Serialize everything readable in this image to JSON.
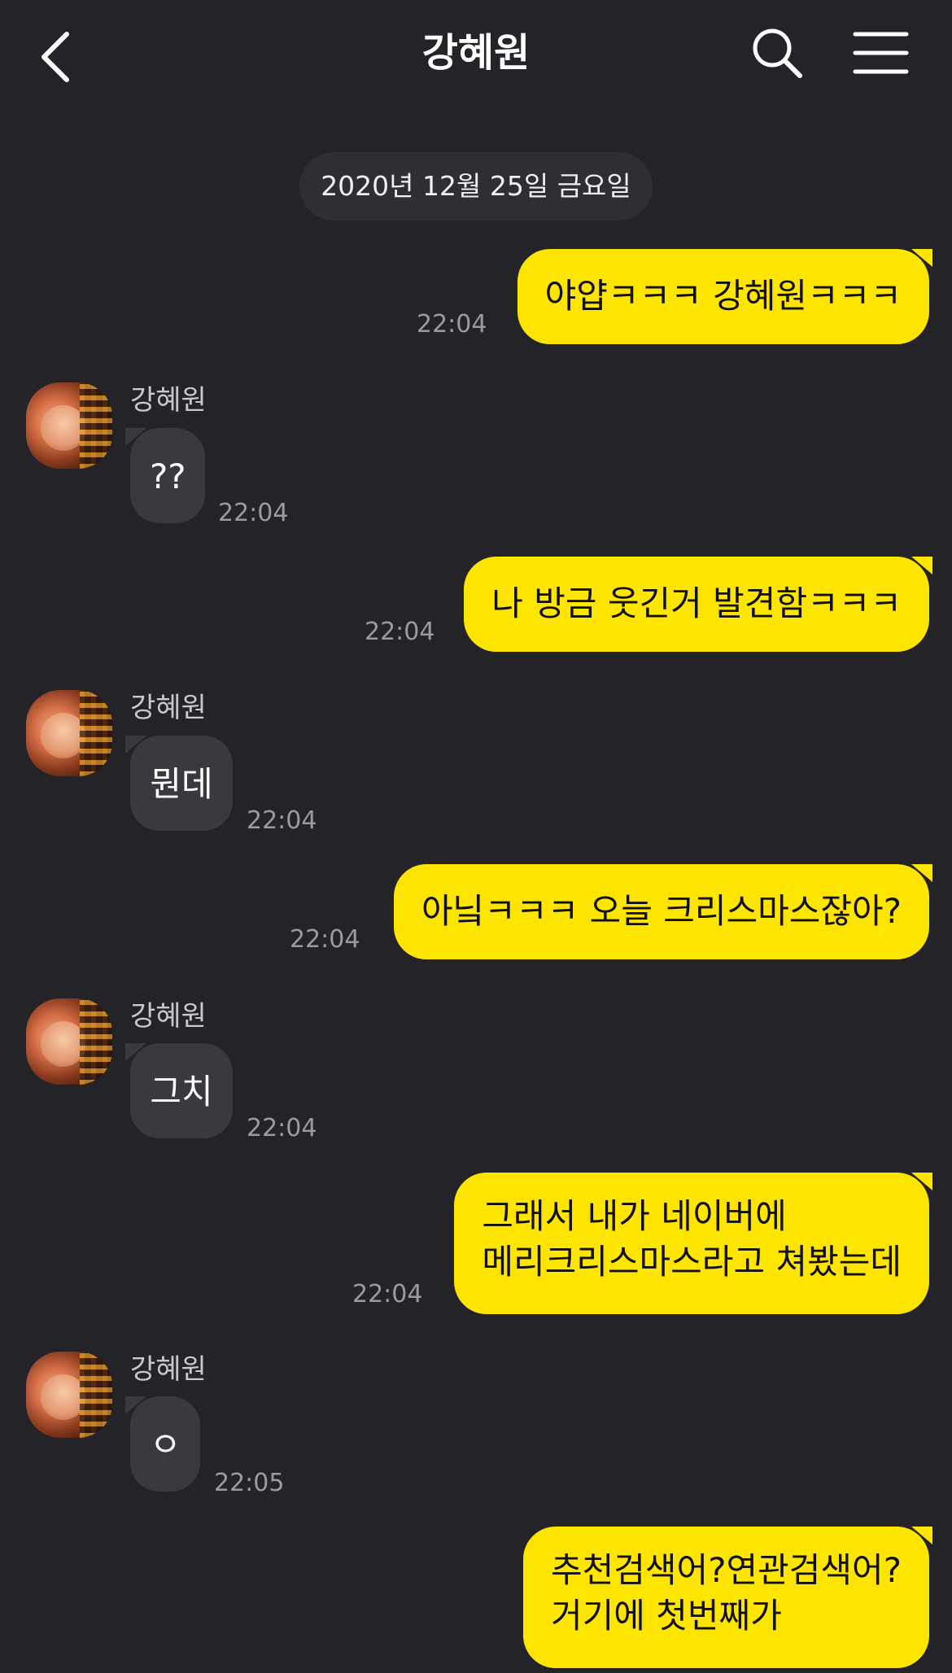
{
  "header": {
    "title": "강혜원",
    "back_icon": "chevron-left-icon",
    "search_icon": "search-icon",
    "menu_icon": "menu-icon"
  },
  "date_divider": "2020년 12월 25일 금요일",
  "colors": {
    "background": "#242428",
    "sent_bubble": "#fee500",
    "received_bubble": "#39393e"
  },
  "messages": [
    {
      "direction": "sent",
      "text": "야얍ㅋㅋㅋ 강혜원ㅋㅋㅋ",
      "time": "22:04"
    },
    {
      "direction": "received",
      "sender": "강혜원",
      "text": "??",
      "time": "22:04"
    },
    {
      "direction": "sent",
      "text": "나 방금 웃긴거 발견함ㅋㅋㅋ",
      "time": "22:04"
    },
    {
      "direction": "received",
      "sender": "강혜원",
      "text": "뭔데",
      "time": "22:04"
    },
    {
      "direction": "sent",
      "text": "아닠ㅋㅋㅋ 오늘 크리스마스잖아?",
      "time": "22:04"
    },
    {
      "direction": "received",
      "sender": "강혜원",
      "text": "그치",
      "time": "22:04"
    },
    {
      "direction": "sent",
      "lines": [
        "그래서 내가 네이버에",
        "메리크리스마스라고 쳐봤는데"
      ],
      "time": "22:04"
    },
    {
      "direction": "received",
      "sender": "강혜원",
      "text": "ㅇ",
      "time": "22:05"
    },
    {
      "direction": "sent",
      "lines": [
        "추천검색어?연관검색어?",
        "거기에 첫번째가"
      ]
    }
  ]
}
